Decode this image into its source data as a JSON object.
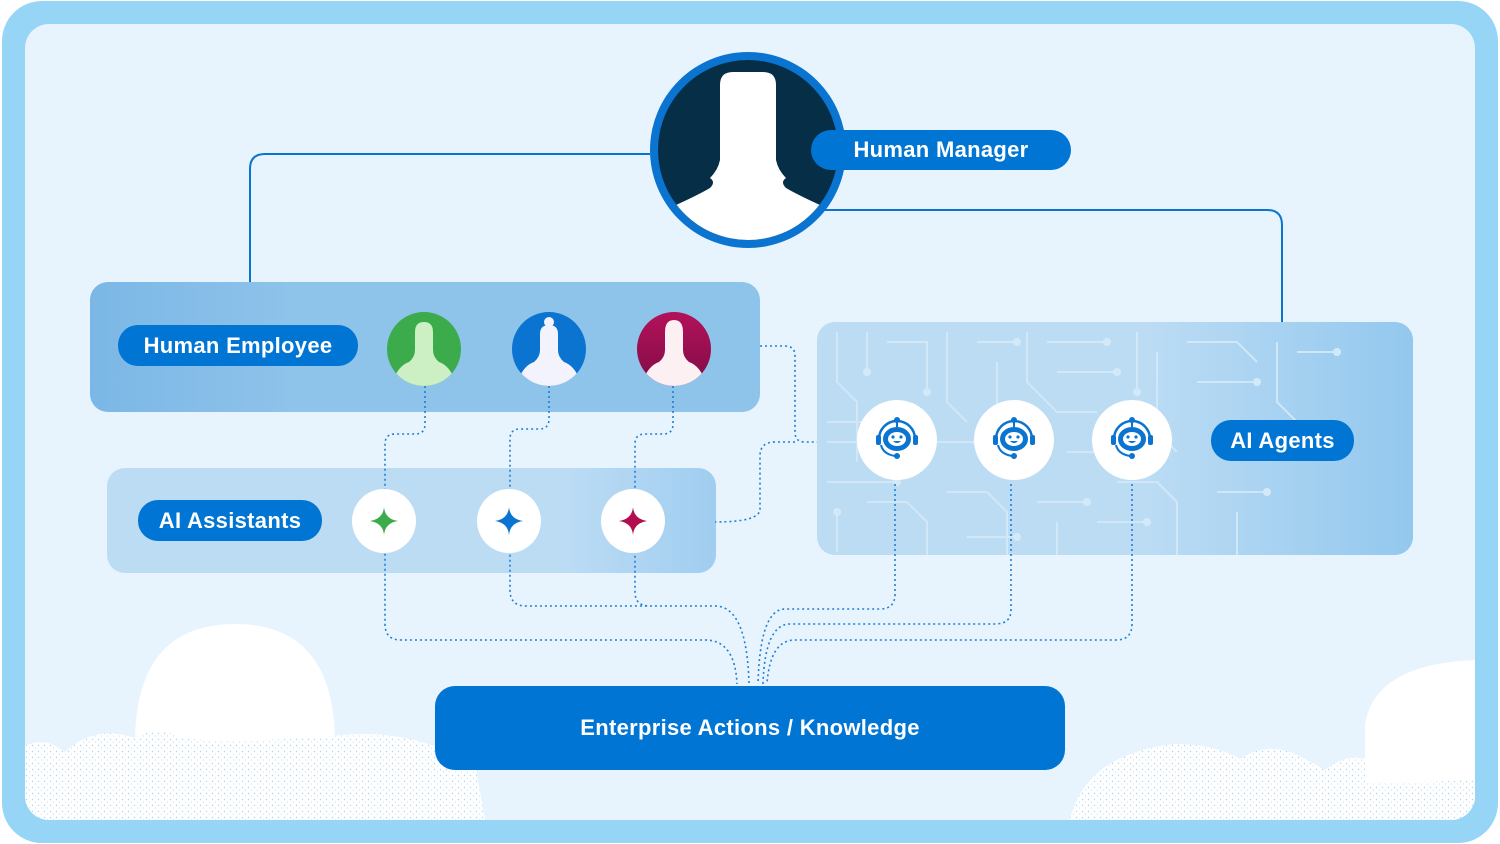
{
  "diagram": {
    "manager": {
      "label": "Human Manager"
    },
    "employees": {
      "label": "Human Employee",
      "avatars": [
        {
          "name": "employee-green",
          "color": "#3bab4c",
          "silhouette": "#cdefc4"
        },
        {
          "name": "employee-blue",
          "color": "#0a74d0",
          "silhouette": "#f3f3fd"
        },
        {
          "name": "employee-magenta",
          "color": "#a8104f",
          "silhouette": "#fdf0f3"
        }
      ]
    },
    "assistants": {
      "label": "AI Assistants",
      "sparkles": [
        {
          "color": "#3bab4c"
        },
        {
          "color": "#0a74d0"
        },
        {
          "color": "#b10d4f"
        }
      ]
    },
    "agents": {
      "label": "AI Agents",
      "count": 3
    },
    "enterprise": {
      "label": "Enterprise Actions / Knowledge"
    },
    "colors": {
      "primary": "#0075d4",
      "frame": "#97d5f6",
      "background": "#e8f4fd",
      "manager_dark": "#062f47"
    }
  }
}
